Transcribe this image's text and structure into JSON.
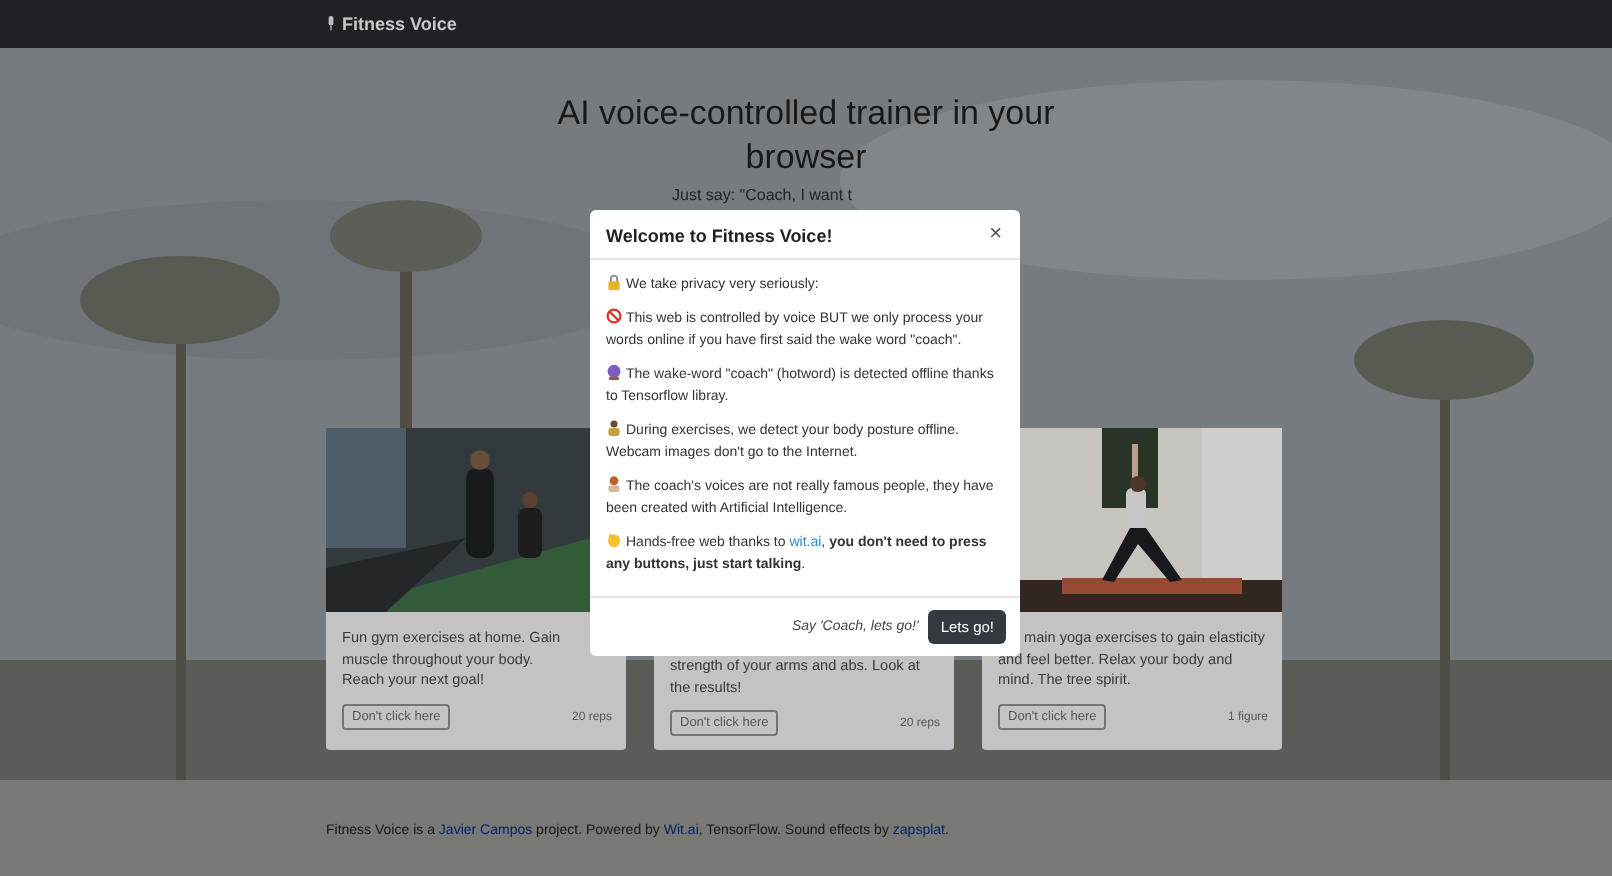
{
  "navbar": {
    "brand": "Fitness Voice"
  },
  "hero": {
    "title": "AI voice-controlled trainer in your browser",
    "subtitle": "Just say: \"Coach, I want t"
  },
  "cards": [
    {
      "kind": "gym",
      "text": "Fun gym exercises at home. Gain muscle throughout your body. Reach your next goal!",
      "button": "Don't click here",
      "meta": "20 reps"
    },
    {
      "kind": "hidden",
      "text": "strength of your arms and abs. Look at the results!",
      "button": "Don't click here",
      "meta": "20 reps"
    },
    {
      "kind": "yoga",
      "text": "main yoga exercises to gain elasticity and feel better. Relax your body and mind. The tree spirit.",
      "button": "Don't click here",
      "meta": "1 figure"
    }
  ],
  "footer": [
    {
      "kind": "text",
      "text": "Fitness Voice is a "
    },
    {
      "kind": "link",
      "text": "Javier Campos"
    },
    {
      "kind": "text",
      "text": " project. Powered by "
    },
    {
      "kind": "link",
      "text": "Wit.ai"
    },
    {
      "kind": "text",
      "text": ", TensorFlow. Sound effects by "
    },
    {
      "kind": "link",
      "text": "zapsplat"
    },
    {
      "kind": "text",
      "text": "."
    }
  ],
  "modal": {
    "title": "Welcome to Fitness Voice!",
    "close": "×",
    "paragraphs": [
      {
        "kind": "lock",
        "parts": [
          {
            "kind": "text",
            "text": "We take privacy very seriously:"
          }
        ]
      },
      {
        "kind": "no-entry",
        "parts": [
          {
            "kind": "text",
            "text": "This web is controlled by voice BUT we only process your words online if you have first said the wake word \"coach\"."
          }
        ]
      },
      {
        "kind": "ball",
        "parts": [
          {
            "kind": "text",
            "text": "The wake-word \"coach\" (hotword) is detected offline thanks to Tensorflow libray."
          }
        ]
      },
      {
        "kind": "person",
        "parts": [
          {
            "kind": "text",
            "text": "During exercises, we detect your body posture offline. Webcam images don't go to the Internet."
          }
        ]
      },
      {
        "kind": "woman",
        "parts": [
          {
            "kind": "text",
            "text": "The coach's voices are not really famous people, they have been created with Artificial Intelligence."
          }
        ]
      },
      {
        "kind": "hand",
        "parts": [
          {
            "kind": "text",
            "text": "Hands-free web thanks to "
          },
          {
            "kind": "link",
            "text": "wit.ai"
          },
          {
            "kind": "text",
            "text": ", "
          },
          {
            "kind": "bold",
            "text": "you don't need to press any buttons, just start talking"
          },
          {
            "kind": "text",
            "text": "."
          }
        ]
      }
    ],
    "hint": "Say 'Coach, lets go!'",
    "button": "Lets go!"
  }
}
